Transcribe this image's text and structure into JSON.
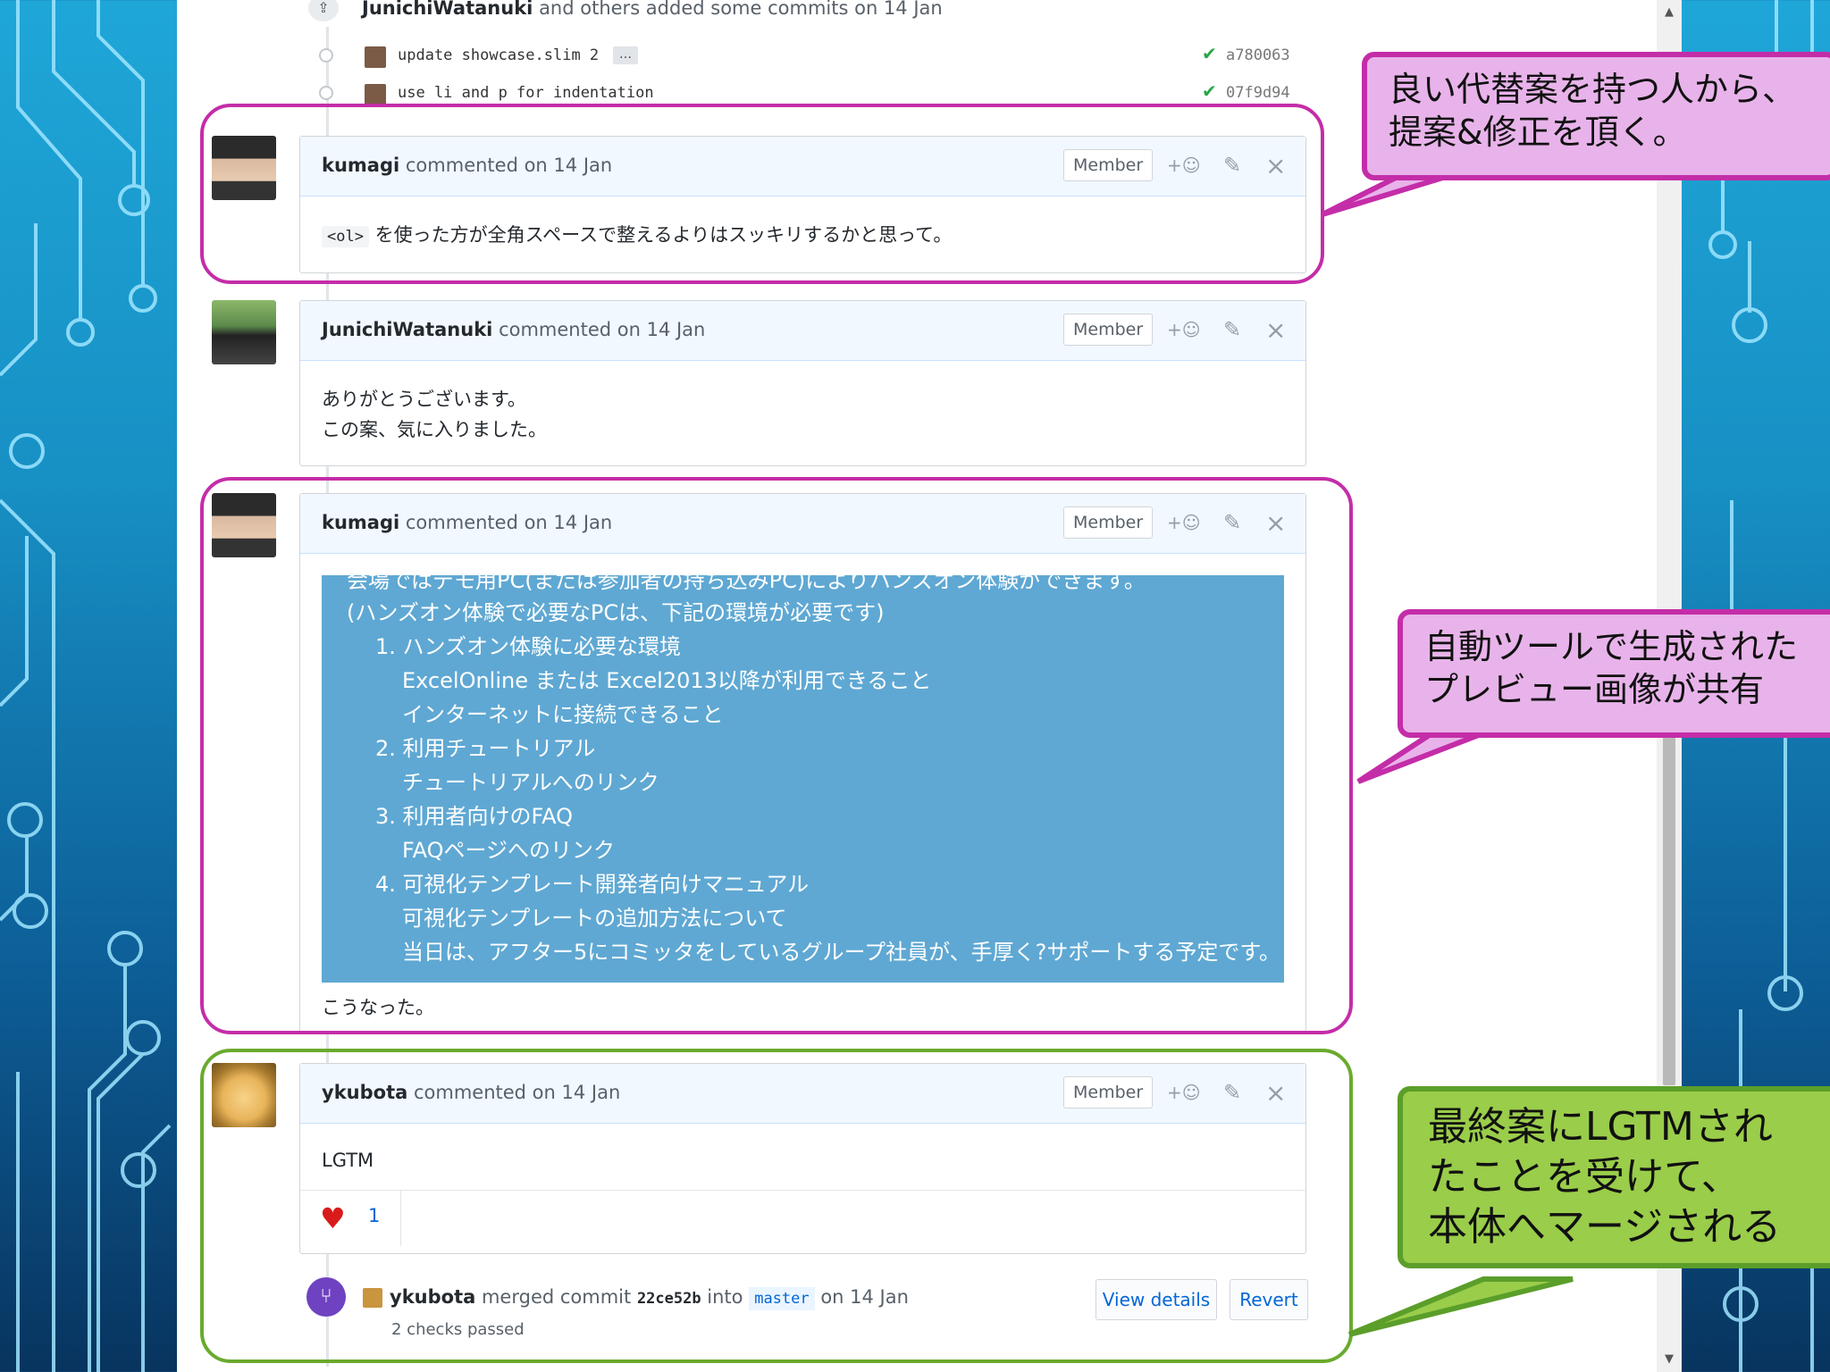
{
  "commits_header": {
    "author": "JunichiWatanuki",
    "text": "and others added some commits on 14 Jan",
    "commits": [
      {
        "message": "update showcase.slim 2",
        "more": "…",
        "sha": "a780063"
      },
      {
        "message": "use li and p for indentation",
        "sha": "07f9d94"
      }
    ]
  },
  "comments": [
    {
      "author": "kumagi",
      "meta": "commented on 14 Jan",
      "badge": "Member",
      "code": "<ol>",
      "text": "を使った方が全角スペースで整えるよりはスッキリするかと思って。"
    },
    {
      "author": "JunichiWatanuki",
      "meta": "commented on 14 Jan",
      "badge": "Member",
      "lines": [
        "ありがとうございます。",
        "この案、気に入りました。"
      ]
    },
    {
      "author": "kumagi",
      "meta": "commented on 14 Jan",
      "badge": "Member",
      "preview_lines": [
        "会場ではデモ用PC(または参加者の持ち込みPC)によりハンズオン体験ができます。",
        "(ハンズオン体験で必要なPCは、下記の環境が必要です)",
        "1. ハンズオン体験に必要な環境",
        "ExcelOnline または Excel2013以降が利用できること",
        "インターネットに接続できること",
        "2. 利用チュートリアル",
        "チュートリアルへのリンク",
        "3. 利用者向けのFAQ",
        "FAQページへのリンク",
        "4. 可視化テンプレート開発者向けマニュアル",
        "可視化テンプレートの追加方法について",
        "当日は、アフター5にコミッタをしているグループ社員が、手厚く?サポートする予定です。"
      ],
      "after": "こうなった。"
    },
    {
      "author": "ykubota",
      "meta": "commented on 14 Jan",
      "badge": "Member",
      "text": "LGTM",
      "reaction_count": "1"
    }
  ],
  "merge": {
    "author": "ykubota",
    "action": "merged commit",
    "sha": "22ce52b",
    "into": "into",
    "branch": "master",
    "date": "on 14 Jan",
    "checks": "2 checks passed",
    "view_details": "View details",
    "revert": "Revert"
  },
  "callouts": {
    "c1": [
      "良い代替案を持つ人から、",
      "提案&修正を頂く。"
    ],
    "c2": [
      "自動ツールで生成された",
      "プレビュー画像が共有"
    ],
    "c3": [
      "最終案にLGTMされ",
      "たことを受けて、",
      "本体へマージされる"
    ]
  },
  "colors": {
    "callout_pink": "#e8b3ea",
    "callout_border": "#c42da8",
    "callout_green": "#9acd4a",
    "preview_bg": "#5fa8d3"
  }
}
